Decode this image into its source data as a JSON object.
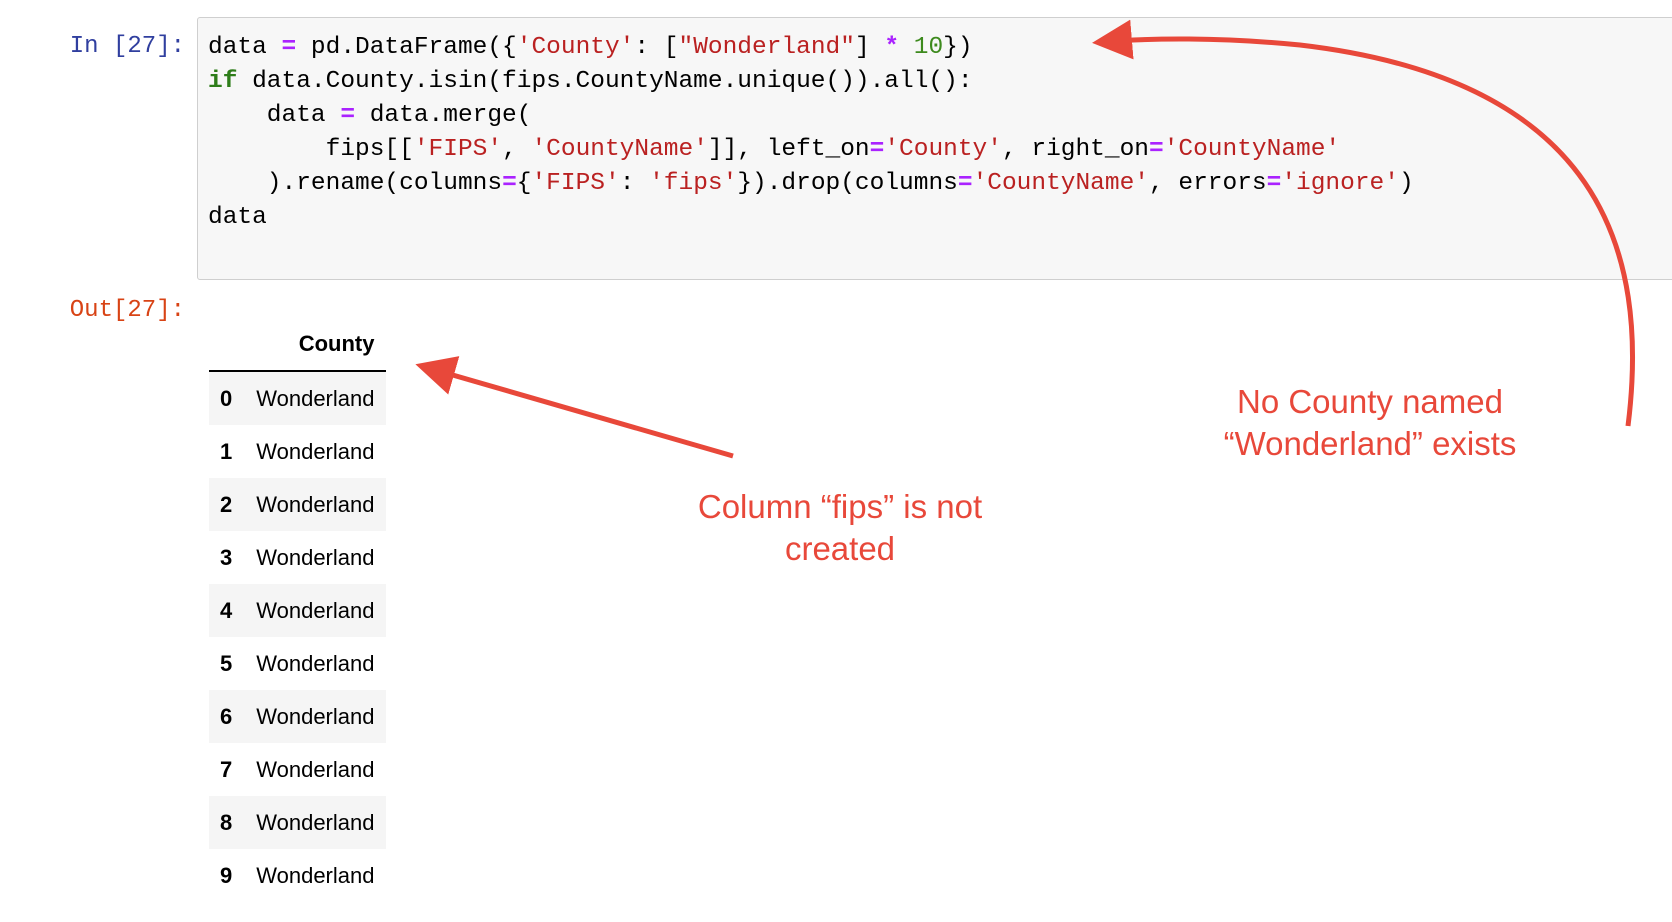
{
  "notebook": {
    "input_prompt": "In [27]:",
    "output_prompt": "Out[27]:",
    "code_lines": [
      [
        {
          "t": "data ",
          "c": ""
        },
        {
          "t": "=",
          "c": "op"
        },
        {
          "t": " pd.DataFrame({",
          "c": ""
        },
        {
          "t": "'County'",
          "c": "str"
        },
        {
          "t": ": [",
          "c": ""
        },
        {
          "t": "\"Wonderland\"",
          "c": "str"
        },
        {
          "t": "] ",
          "c": ""
        },
        {
          "t": "*",
          "c": "op"
        },
        {
          "t": " ",
          "c": ""
        },
        {
          "t": "10",
          "c": "num"
        },
        {
          "t": "})",
          "c": ""
        }
      ],
      [
        {
          "t": "if",
          "c": "kw"
        },
        {
          "t": " data.County.isin(fips.CountyName.unique()).all():",
          "c": ""
        }
      ],
      [
        {
          "t": "    data ",
          "c": ""
        },
        {
          "t": "=",
          "c": "op"
        },
        {
          "t": " data.merge(",
          "c": ""
        }
      ],
      [
        {
          "t": "        fips[[",
          "c": ""
        },
        {
          "t": "'FIPS'",
          "c": "str"
        },
        {
          "t": ", ",
          "c": ""
        },
        {
          "t": "'CountyName'",
          "c": "str"
        },
        {
          "t": "]], left_on",
          "c": ""
        },
        {
          "t": "=",
          "c": "op"
        },
        {
          "t": "'County'",
          "c": "str"
        },
        {
          "t": ", right_on",
          "c": ""
        },
        {
          "t": "=",
          "c": "op"
        },
        {
          "t": "'CountyName'",
          "c": "str"
        }
      ],
      [
        {
          "t": "    ).rename(columns",
          "c": ""
        },
        {
          "t": "=",
          "c": "op"
        },
        {
          "t": "{",
          "c": ""
        },
        {
          "t": "'FIPS'",
          "c": "str"
        },
        {
          "t": ": ",
          "c": ""
        },
        {
          "t": "'fips'",
          "c": "str"
        },
        {
          "t": "}).drop(columns",
          "c": ""
        },
        {
          "t": "=",
          "c": "op"
        },
        {
          "t": "'CountyName'",
          "c": "str"
        },
        {
          "t": ", errors",
          "c": ""
        },
        {
          "t": "=",
          "c": "op"
        },
        {
          "t": "'ignore'",
          "c": "str"
        },
        {
          "t": ")",
          "c": ""
        }
      ],
      [
        {
          "t": "data",
          "c": ""
        }
      ]
    ]
  },
  "output_table": {
    "columns": [
      "County"
    ],
    "rows": [
      {
        "index": "0",
        "County": "Wonderland"
      },
      {
        "index": "1",
        "County": "Wonderland"
      },
      {
        "index": "2",
        "County": "Wonderland"
      },
      {
        "index": "3",
        "County": "Wonderland"
      },
      {
        "index": "4",
        "County": "Wonderland"
      },
      {
        "index": "5",
        "County": "Wonderland"
      },
      {
        "index": "6",
        "County": "Wonderland"
      },
      {
        "index": "7",
        "County": "Wonderland"
      },
      {
        "index": "8",
        "County": "Wonderland"
      },
      {
        "index": "9",
        "County": "Wonderland"
      }
    ]
  },
  "annotations": {
    "fips_note": {
      "line1": "Column “fips” is not",
      "line2": "created"
    },
    "county_note": {
      "line1": "No County named",
      "line2": "“Wonderland” exists"
    },
    "color": "#e8483a"
  }
}
